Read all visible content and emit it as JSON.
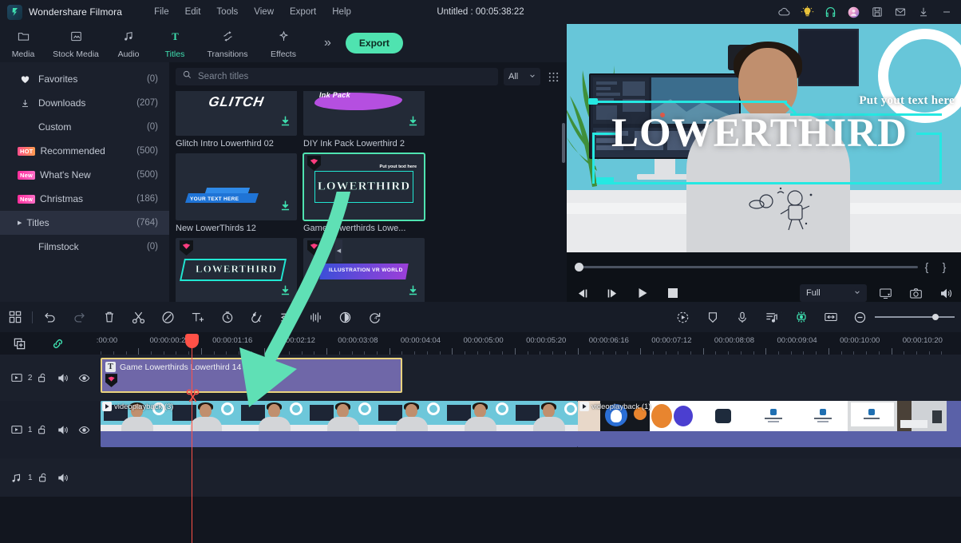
{
  "app": {
    "brand": "Wondershare Filmora",
    "document_title": "Untitled : 00:05:38:22"
  },
  "menu": [
    "File",
    "Edit",
    "Tools",
    "View",
    "Export",
    "Help"
  ],
  "titlebar_icons": [
    "cloud-icon",
    "lightbulb-icon",
    "headset-icon",
    "account-avatar-icon",
    "save-icon",
    "mail-icon",
    "download-icon",
    "minimize-icon"
  ],
  "tabs": [
    {
      "label": "Media",
      "icon": "folder-icon",
      "active": false
    },
    {
      "label": "Stock Media",
      "icon": "stock-media-icon",
      "active": false
    },
    {
      "label": "Audio",
      "icon": "audio-note-icon",
      "active": false
    },
    {
      "label": "Titles",
      "icon": "titles-T-icon",
      "active": true
    },
    {
      "label": "Transitions",
      "icon": "transitions-icon",
      "active": false
    },
    {
      "label": "Effects",
      "icon": "effects-icon",
      "active": false
    }
  ],
  "toolbar": {
    "more_label": "»",
    "export_label": "Export"
  },
  "sidebar": {
    "items": [
      {
        "label": "Favorites",
        "count": "(0)",
        "icon": "heart-icon",
        "badge": "",
        "selected": false
      },
      {
        "label": "Downloads",
        "count": "(207)",
        "icon": "download-icon",
        "badge": "",
        "selected": false
      },
      {
        "label": "Custom",
        "count": "(0)",
        "icon": "",
        "badge": "",
        "selected": false
      },
      {
        "label": "Recommended",
        "count": "(500)",
        "icon": "",
        "badge": "HOT",
        "selected": false
      },
      {
        "label": "What's New",
        "count": "(500)",
        "icon": "",
        "badge": "New",
        "selected": false
      },
      {
        "label": "Christmas",
        "count": "(186)",
        "icon": "",
        "badge": "New",
        "selected": false
      },
      {
        "label": "Titles",
        "count": "(764)",
        "icon": "triangle-right-icon",
        "badge": "",
        "selected": true
      },
      {
        "label": "Filmstock",
        "count": "(0)",
        "icon": "",
        "badge": "",
        "selected": false
      }
    ]
  },
  "browser": {
    "search_placeholder": "Search titles",
    "search_value": "",
    "filter_label": "All",
    "grid_icon": "grid-view-icon",
    "cards": [
      {
        "name": "Glitch Intro Lowerthird 02",
        "art": "glitch",
        "art_text": "GLITCH",
        "downloadable": true,
        "gem": false,
        "selected": false
      },
      {
        "name": "DIY Ink Pack Lowerthird 2",
        "art": "ink",
        "art_text": "Ink Pack",
        "downloadable": true,
        "gem": false,
        "selected": false
      },
      {
        "name": "New LowerThirds 12",
        "art": "bluebar",
        "art_text": "YOUR TEXT HERE",
        "downloadable": true,
        "gem": false,
        "selected": false
      },
      {
        "name": "Game Lowerthirds Lowe...",
        "art": "lowerthird",
        "art_text": "LOWERTHIRD",
        "art_subtext": "Put yout text here",
        "downloadable": false,
        "gem": true,
        "selected": true
      },
      {
        "name": "",
        "art": "lowerthird3",
        "art_text": "LOWERTHIRD",
        "downloadable": true,
        "gem": true,
        "selected": false
      },
      {
        "name": "",
        "art": "vr",
        "art_text": "ILLUSTRATION VR WORLD",
        "downloadable": true,
        "gem": true,
        "selected": false
      }
    ]
  },
  "preview": {
    "overlay_small_text": "Put yout text here",
    "overlay_big_text": "LOWERTHIRD",
    "quality_label": "Full",
    "controls": [
      "step-back-icon",
      "step-forward-icon",
      "play-icon",
      "stop-icon"
    ],
    "right_controls": [
      "screen-snapshot-icon",
      "camera-snapshot-icon",
      "volume-icon"
    ],
    "mark_in_label": "{",
    "mark_out_label": "}"
  },
  "timeline_toolbar": {
    "left_icons": [
      "project-layout-icon",
      "undo-icon",
      "redo-icon",
      "delete-icon",
      "split-scissors-icon",
      "crop-icon",
      "add-text-icon",
      "speed-icon",
      "color-icon",
      "audio-mixer-icon",
      "audio-waveform-icon",
      "marker-icon",
      "render-preview-icon"
    ],
    "right_icons": [
      "auto-reframe-icon",
      "shield-icon",
      "record-voiceover-icon",
      "beat-detection-icon",
      "green-screen-icon",
      "fit-timeline-icon",
      "zoom-out-icon"
    ],
    "sub_icons": [
      "duplicate-icon",
      "link-icon"
    ]
  },
  "ruler": {
    "labels": [
      ":00:00",
      "00:00:00:20",
      "00:00:01:16",
      "00:00:02:12",
      "00:00:03:08",
      "00:00:04:04",
      "00:00:05:00",
      "00:00:05:20",
      "00:00:06:16",
      "00:00:07:12",
      "00:00:08:08",
      "00:00:09:04",
      "00:00:10:00",
      "00:00:10:20"
    ]
  },
  "tracks": [
    {
      "type": "video",
      "number": "2",
      "icons": [
        "video-track-icon",
        "unlock-icon",
        "audio-on-icon",
        "eye-visible-icon"
      ]
    },
    {
      "type": "video",
      "number": "1",
      "icons": [
        "video-track-icon",
        "unlock-icon",
        "audio-on-icon",
        "eye-visible-icon"
      ]
    },
    {
      "type": "audio",
      "number": "1",
      "icons": [
        "audio-track-icon",
        "unlock-icon",
        "audio-on-icon"
      ]
    }
  ],
  "clips": {
    "title_clip": {
      "label": "Game Lowerthirds Lowerthird 14",
      "icon": "title-T-icon",
      "gem": true
    },
    "video_clip_1": {
      "label": "videoplayback (3)",
      "icon": "play-icon"
    },
    "video_clip_2": {
      "label": "videoplayback (1)",
      "icon": "play-icon"
    }
  },
  "colors": {
    "accent": "#4fe3b0",
    "playhead": "#ff5147",
    "title_clip": "#6f67a8",
    "clip_selected_border": "#e9d27e",
    "video_clip": "#5a61a8",
    "panel_bg": "#1b202c",
    "app_bg": "#12161f",
    "chrome_bg": "#171c27",
    "cyan_overlay": "#25e8e2",
    "annotation_arrow": "#5fe0b5"
  }
}
